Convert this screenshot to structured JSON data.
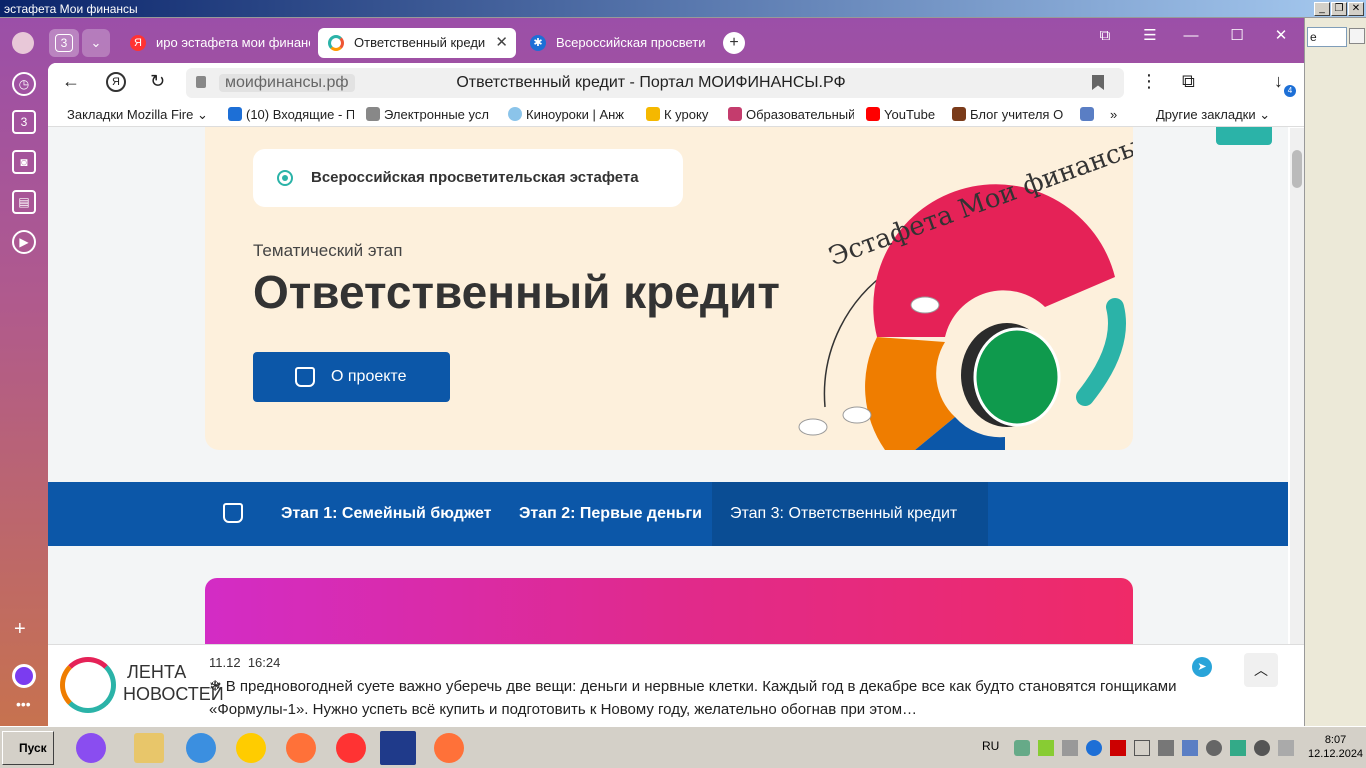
{
  "outer_window": {
    "title": "эстафета Мои финансы",
    "controls": [
      "_",
      "❐",
      "✕"
    ]
  },
  "tabs": {
    "count_badge": "3",
    "items": [
      {
        "label": "иро эстафета мои финанс",
        "active": false
      },
      {
        "label": "Ответственный креди",
        "active": true
      },
      {
        "label": "Всероссийская просвети",
        "active": false
      }
    ],
    "new_tab": "+"
  },
  "address": {
    "domain": "мoифинансы.рф",
    "title": "Ответственный кредит - Портал МОИФИНАНСЫ.РФ",
    "downloads_badge": "4"
  },
  "sidebar": {
    "badge": "3"
  },
  "bookmarks": {
    "items": [
      {
        "label": "Закладки Mozilla Fire"
      },
      {
        "label": "(10) Входящие - П"
      },
      {
        "label": "Электронные усл"
      },
      {
        "label": "Киноуроки | Анж"
      },
      {
        "label": "К уроку"
      },
      {
        "label": "Образовательный"
      },
      {
        "label": "YouTube"
      },
      {
        "label": "Блог учителя О"
      }
    ],
    "more": "»",
    "other": "Другие закладки"
  },
  "hero": {
    "chip": "Всероссийская просветительская эстафета",
    "stage_label": "Тематический этап",
    "title": "Ответственный кредит",
    "about_button": "О проекте",
    "logo_text": "Эстафета Мои финансы"
  },
  "nav": {
    "items": [
      {
        "label": "Этап 1: Семейный бюджет",
        "active": false
      },
      {
        "label": "Этап 2: Первые деньги",
        "active": false
      },
      {
        "label": "Этап 3: Ответственный кредит",
        "active": true
      }
    ]
  },
  "news": {
    "brand_line1": "ЛЕНТА",
    "brand_line2": "НОВОСТЕЙ",
    "date": "11.12",
    "time": "16:24",
    "text": "❄ В предновогодней суете важно уберечь две вещи: деньги и нервные клетки. Каждый год в декабре все как будто становятся гонщиками «Формулы-1». Нужно успеть всё купить и подготовить к Новому году, желательно обогнав при этом…"
  },
  "taskbar": {
    "start": "Пуск",
    "lang": "RU",
    "clock_time": "8:07",
    "clock_date": "12.12.2024"
  },
  "right_window": {
    "field_text": "е"
  },
  "colors": {
    "primary_blue": "#0c57a8",
    "hero_bg": "#fdf0dc",
    "teal": "#2bb3a8"
  }
}
